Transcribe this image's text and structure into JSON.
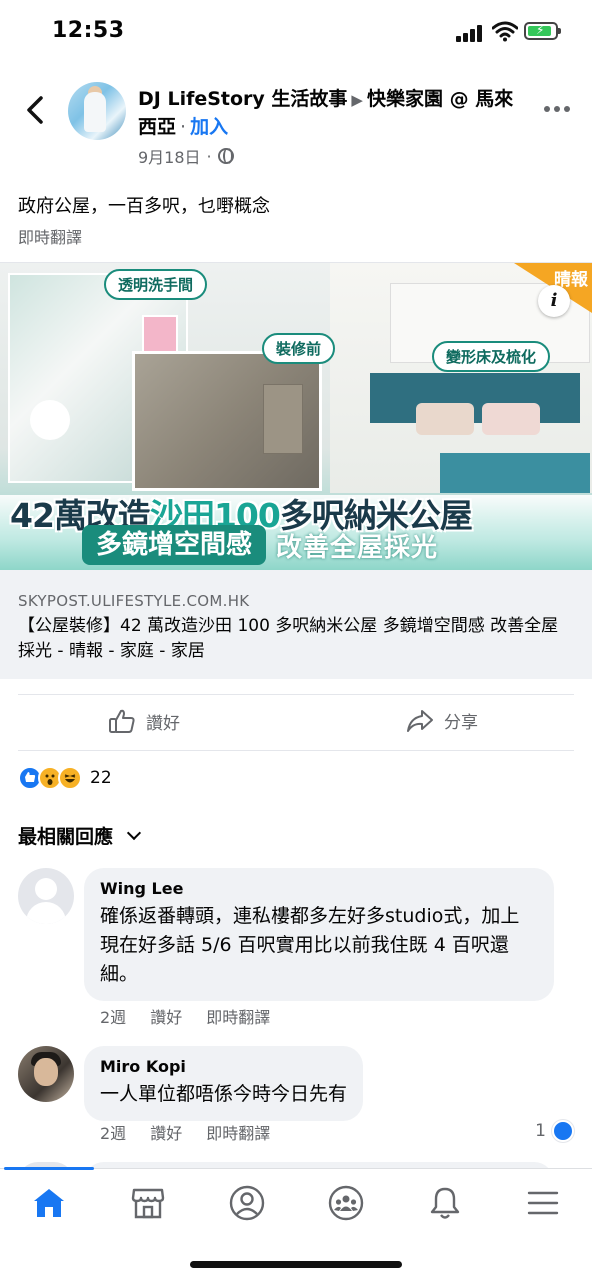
{
  "status_bar": {
    "time": "12:53"
  },
  "post": {
    "page_name": "DJ LifeStory 生活故事",
    "group_name": "快樂家園 @ 馬來西亞",
    "join_label": "加入",
    "date": "9月18日",
    "date_separator": "·",
    "text": "政府公屋，一百多呎，乜嘢概念",
    "translate_label": "即時翻譯"
  },
  "link_preview": {
    "image": {
      "tag_1": "透明洗手間",
      "tag_2": "裝修前",
      "tag_3": "變形床及梳化",
      "brand": "晴報",
      "info_icon": "i",
      "headline_part_1": "42萬改造",
      "headline_part_2": "沙田100",
      "headline_part_3": "多呎納米公屋",
      "sub_1": "多鏡增空間感",
      "sub_2": "改善全屋採光"
    },
    "domain": "SKYPOST.ULIFESTYLE.COM.HK",
    "title": "【公屋裝修】42 萬改造沙田 100 多呎納米公屋 多鏡增空間感 改善全屋採光 - 晴報 - 家庭 - 家居"
  },
  "actions": {
    "like_label": "讚好",
    "share_label": "分享"
  },
  "reactions": {
    "count": "22",
    "types": [
      "like-icon",
      "wow-icon",
      "haha-icon"
    ]
  },
  "comments_sort": {
    "label": "最相關回應"
  },
  "comments": [
    {
      "name": "Wing Lee",
      "text": "確係返番轉頭，連私樓都多左好多studio式，加上現在好多話 5/6 百呎實用比以前我住既 4 百呎還細。",
      "time": "2週",
      "like_label": "讚好",
      "translate_label": "即時翻譯"
    },
    {
      "name": "Miro Kopi",
      "text": "一人單位都唔係今時今日先有",
      "time": "2週",
      "like_label": "讚好",
      "translate_label": "即時翻譯",
      "like_count": "1"
    }
  ],
  "bottom_nav": {
    "items": [
      "home-icon",
      "marketplace-icon",
      "profile-icon",
      "groups-icon",
      "notifications-icon",
      "menu-icon"
    ],
    "active": "home-icon"
  },
  "colors": {
    "accent": "#1877f2",
    "secondary_text": "#65676b",
    "bubble_bg": "#f0f2f5",
    "teal": "#1a8c7c"
  }
}
